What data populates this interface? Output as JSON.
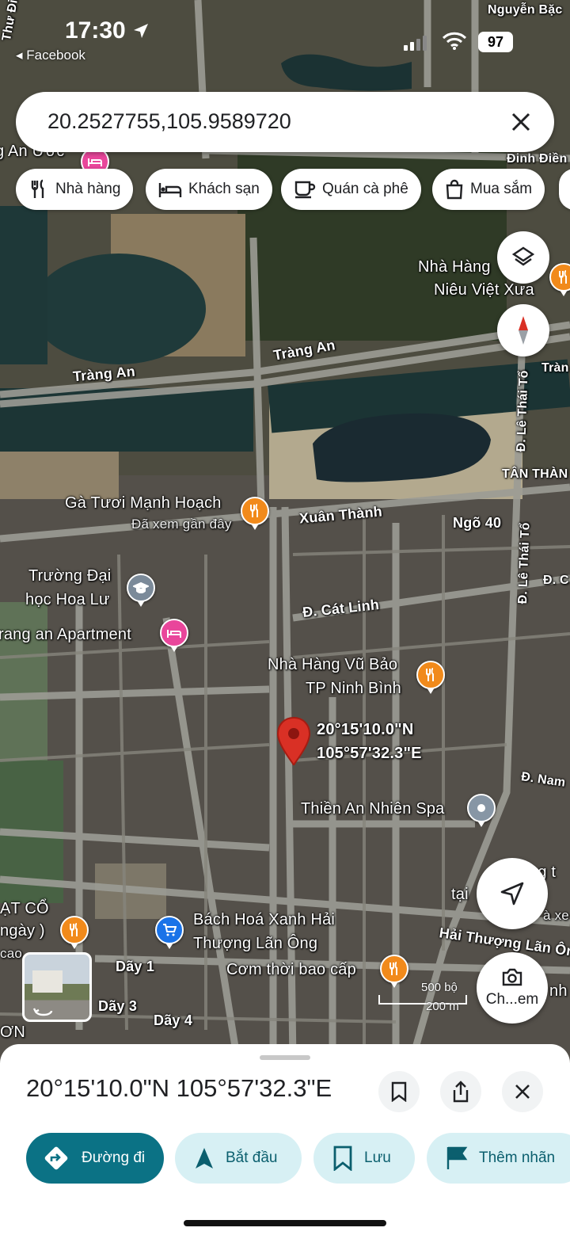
{
  "status_bar": {
    "time": "17:30",
    "back_app": "Facebook",
    "battery": "97"
  },
  "search": {
    "query": "20.2527755,105.9589720"
  },
  "chips": [
    {
      "label": "Nhà hàng",
      "icon": "fork-knife-icon"
    },
    {
      "label": "Khách sạn",
      "icon": "bed-icon"
    },
    {
      "label": "Quán cà phê",
      "icon": "coffee-icon"
    },
    {
      "label": "Mua sắm",
      "icon": "shopping-bag-icon"
    }
  ],
  "map": {
    "labels": {
      "nguyen_bac": "Nguyễn Bặc",
      "an_uoc": "g An Ước",
      "dinh_dien": "Đinh Điền",
      "nha_hang_niu_1": "Nhà Hàng",
      "nha_hang_niu_2": "Niêu Việt Xưa",
      "trang_an_1": "Tràng An",
      "trang_an_2": "Tràng An",
      "trang_right": "Tràn",
      "le_thai_to_1": "Đ. Lê Thái Tổ",
      "le_thai_to_2": "Đ. Lê Thái Tổ",
      "tan_thanh": "TÂN THÀN",
      "ga_tuoi": "Gà Tươi Mạnh Hoạch",
      "ga_tuoi_sub": "Đã xem gần đây",
      "xuan_thanh": "Xuân Thành",
      "ngo_40": "Ngõ 40",
      "truong_1": "Trường Đại",
      "truong_2": "học Hoa Lư",
      "d_c": "Đ. C",
      "cat_linh": "Đ. Cát Linh",
      "trang_an_apt": "rang an Apartment",
      "vu_bao_1": "Nhà Hàng Vũ Bảo",
      "vu_bao_2": "TP Ninh Bình",
      "pin_lat": "20°15'10.0\"N",
      "pin_lng": "105°57'32.3\"E",
      "d_nam": "Đ. Nam",
      "spa": "Thiền An Nhiên Spa",
      "bach_hoa_1": "Bách Hoá Xanh Hải",
      "bach_hoa_2": "Thượng Lãn Ông",
      "hai_thuong": "Hải Thượng Lãn Ông",
      "com_thoi": "Cơm thời bao cấp",
      "at_co": "ẠT CỔ",
      "ngay": "ngày )",
      "cao": "cao",
      "day_1": "Dãy 1",
      "day_3": "Dãy 3",
      "day_4": "Dãy 4",
      "on": "ƠN",
      "tai": "tại",
      "ng_t": "ng t",
      "a_xe": "à xe",
      "nh": "nh",
      "thu_die": "Thư Điể",
      "le_thai_right": "Ô"
    },
    "scale": {
      "imperial": "500 bộ",
      "metric": "200 m"
    },
    "camera_button_label": "Ch...em"
  },
  "place": {
    "coordinates": "20°15'10.0\"N 105°57'32.3\"E"
  },
  "actions": {
    "directions": "Đường đi",
    "start": "Bắt đầu",
    "save": "Lưu",
    "add_label": "Thêm nhãn"
  },
  "colors": {
    "accent": "#0b7285",
    "pin": "#d93025",
    "food_poi": "#f18a1b",
    "hotel_poi": "#e9469b"
  }
}
